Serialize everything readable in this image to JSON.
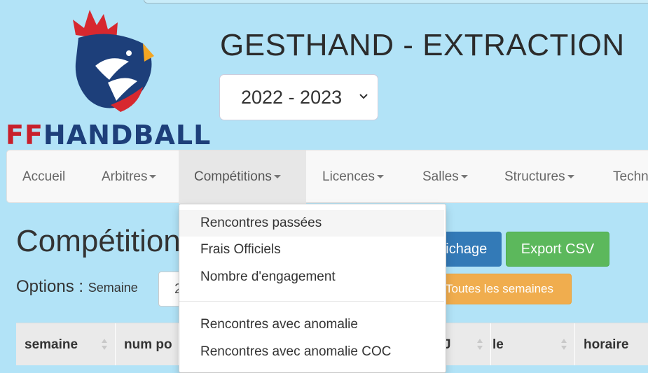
{
  "brand": {
    "logo_text": "FFHANDBALL"
  },
  "header": {
    "title": "GESTHAND - EXTRACTION"
  },
  "season_select": {
    "selected": "2022 - 2023"
  },
  "nav": {
    "items": [
      {
        "label": "Accueil"
      },
      {
        "label": "Arbitres"
      },
      {
        "label": "Compétitions"
      },
      {
        "label": "Licences"
      },
      {
        "label": "Salles"
      },
      {
        "label": "Structures"
      },
      {
        "label": "Techn"
      }
    ]
  },
  "page": {
    "heading": "Compétition",
    "options_label": "Options :",
    "semaine_label": "Semaine",
    "week_value": "2"
  },
  "buttons": {
    "affichage": "fichage",
    "export_csv": "Export CSV",
    "toutes_semaines": "Toutes les semaines"
  },
  "dropdown": {
    "items": [
      {
        "label": "Rencontres passées"
      },
      {
        "label": "Frais Officiels"
      },
      {
        "label": "Nombre d'engagement"
      },
      {
        "label": "Rencontres avec anomalie"
      },
      {
        "label": "Rencontres avec anomalie COC"
      }
    ]
  },
  "table": {
    "headers": [
      {
        "label": "semaine"
      },
      {
        "label": "num po"
      },
      {
        "label": "J"
      },
      {
        "label": "le"
      },
      {
        "label": "horaire"
      }
    ]
  },
  "colors": {
    "background": "#b2e3f7",
    "primary": "#337ab7",
    "success": "#5cb85c",
    "warning": "#f0ad4e",
    "brand_red": "#c8202c",
    "brand_navy": "#1d3f7a"
  }
}
